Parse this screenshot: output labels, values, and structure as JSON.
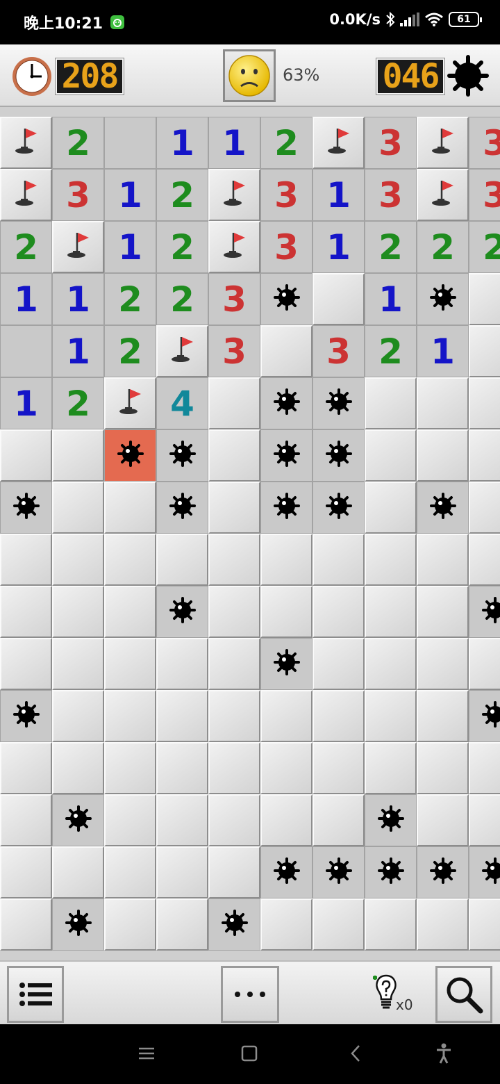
{
  "status_bar": {
    "time": "晚上10:21",
    "net_speed": "0.0K/s",
    "battery": "61"
  },
  "header": {
    "timer": "208",
    "progress": "63%",
    "mine_counter": "046"
  },
  "board": {
    "visible_rows": [
      [
        "F",
        "2",
        "O",
        "1",
        "1",
        "2",
        "F",
        "3",
        "F",
        "3"
      ],
      [
        "F",
        "3",
        "1",
        "2",
        "F",
        "3",
        "1",
        "3",
        "F",
        "3"
      ],
      [
        "2",
        "F",
        "1",
        "2",
        "F",
        "3",
        "1",
        "2",
        "2",
        "2"
      ],
      [
        "1",
        "1",
        "2",
        "2",
        "3",
        "M",
        "C",
        "1",
        "M",
        "C"
      ],
      [
        "O",
        "1",
        "2",
        "F",
        "3",
        "C",
        "3",
        "2",
        "1",
        "C"
      ],
      [
        "1",
        "2",
        "F",
        "4",
        "C",
        "M",
        "M",
        "C",
        "C",
        "C"
      ],
      [
        "C",
        "C",
        "X",
        "M",
        "C",
        "M",
        "M",
        "C",
        "C",
        "C"
      ],
      [
        "M",
        "C",
        "C",
        "M",
        "C",
        "M",
        "M",
        "C",
        "M",
        "C"
      ],
      [
        "C",
        "C",
        "C",
        "C",
        "C",
        "C",
        "C",
        "C",
        "C",
        "C"
      ],
      [
        "C",
        "C",
        "C",
        "M",
        "C",
        "C",
        "C",
        "C",
        "C",
        "M"
      ],
      [
        "C",
        "C",
        "C",
        "C",
        "C",
        "M",
        "C",
        "C",
        "C",
        "C"
      ],
      [
        "M",
        "C",
        "C",
        "C",
        "C",
        "C",
        "C",
        "C",
        "C",
        "M"
      ],
      [
        "C",
        "C",
        "C",
        "C",
        "C",
        "C",
        "C",
        "C",
        "C",
        "C"
      ],
      [
        "C",
        "M",
        "C",
        "C",
        "C",
        "C",
        "C",
        "M",
        "C",
        "C"
      ],
      [
        "C",
        "C",
        "C",
        "C",
        "C",
        "M",
        "M",
        "M",
        "M",
        "M"
      ],
      [
        "C",
        "M",
        "C",
        "C",
        "M",
        "C",
        "C",
        "C",
        "C",
        "C"
      ]
    ],
    "number_colors": {
      "1": "#1414c8",
      "2": "#1e8c1e",
      "3": "#cc3333",
      "4": "#11889a"
    },
    "exploded_color": "#e46a50"
  },
  "bottom_bar": {
    "hint_count": "x0"
  },
  "icons": [
    "clock-icon",
    "sad-face-icon",
    "mine-icon",
    "menu-list-icon",
    "more-icon",
    "hint-bulb-icon",
    "zoom-icon",
    "flag-icon",
    "nav-menu-icon",
    "nav-home-icon",
    "nav-back-icon",
    "nav-accessibility-icon"
  ]
}
